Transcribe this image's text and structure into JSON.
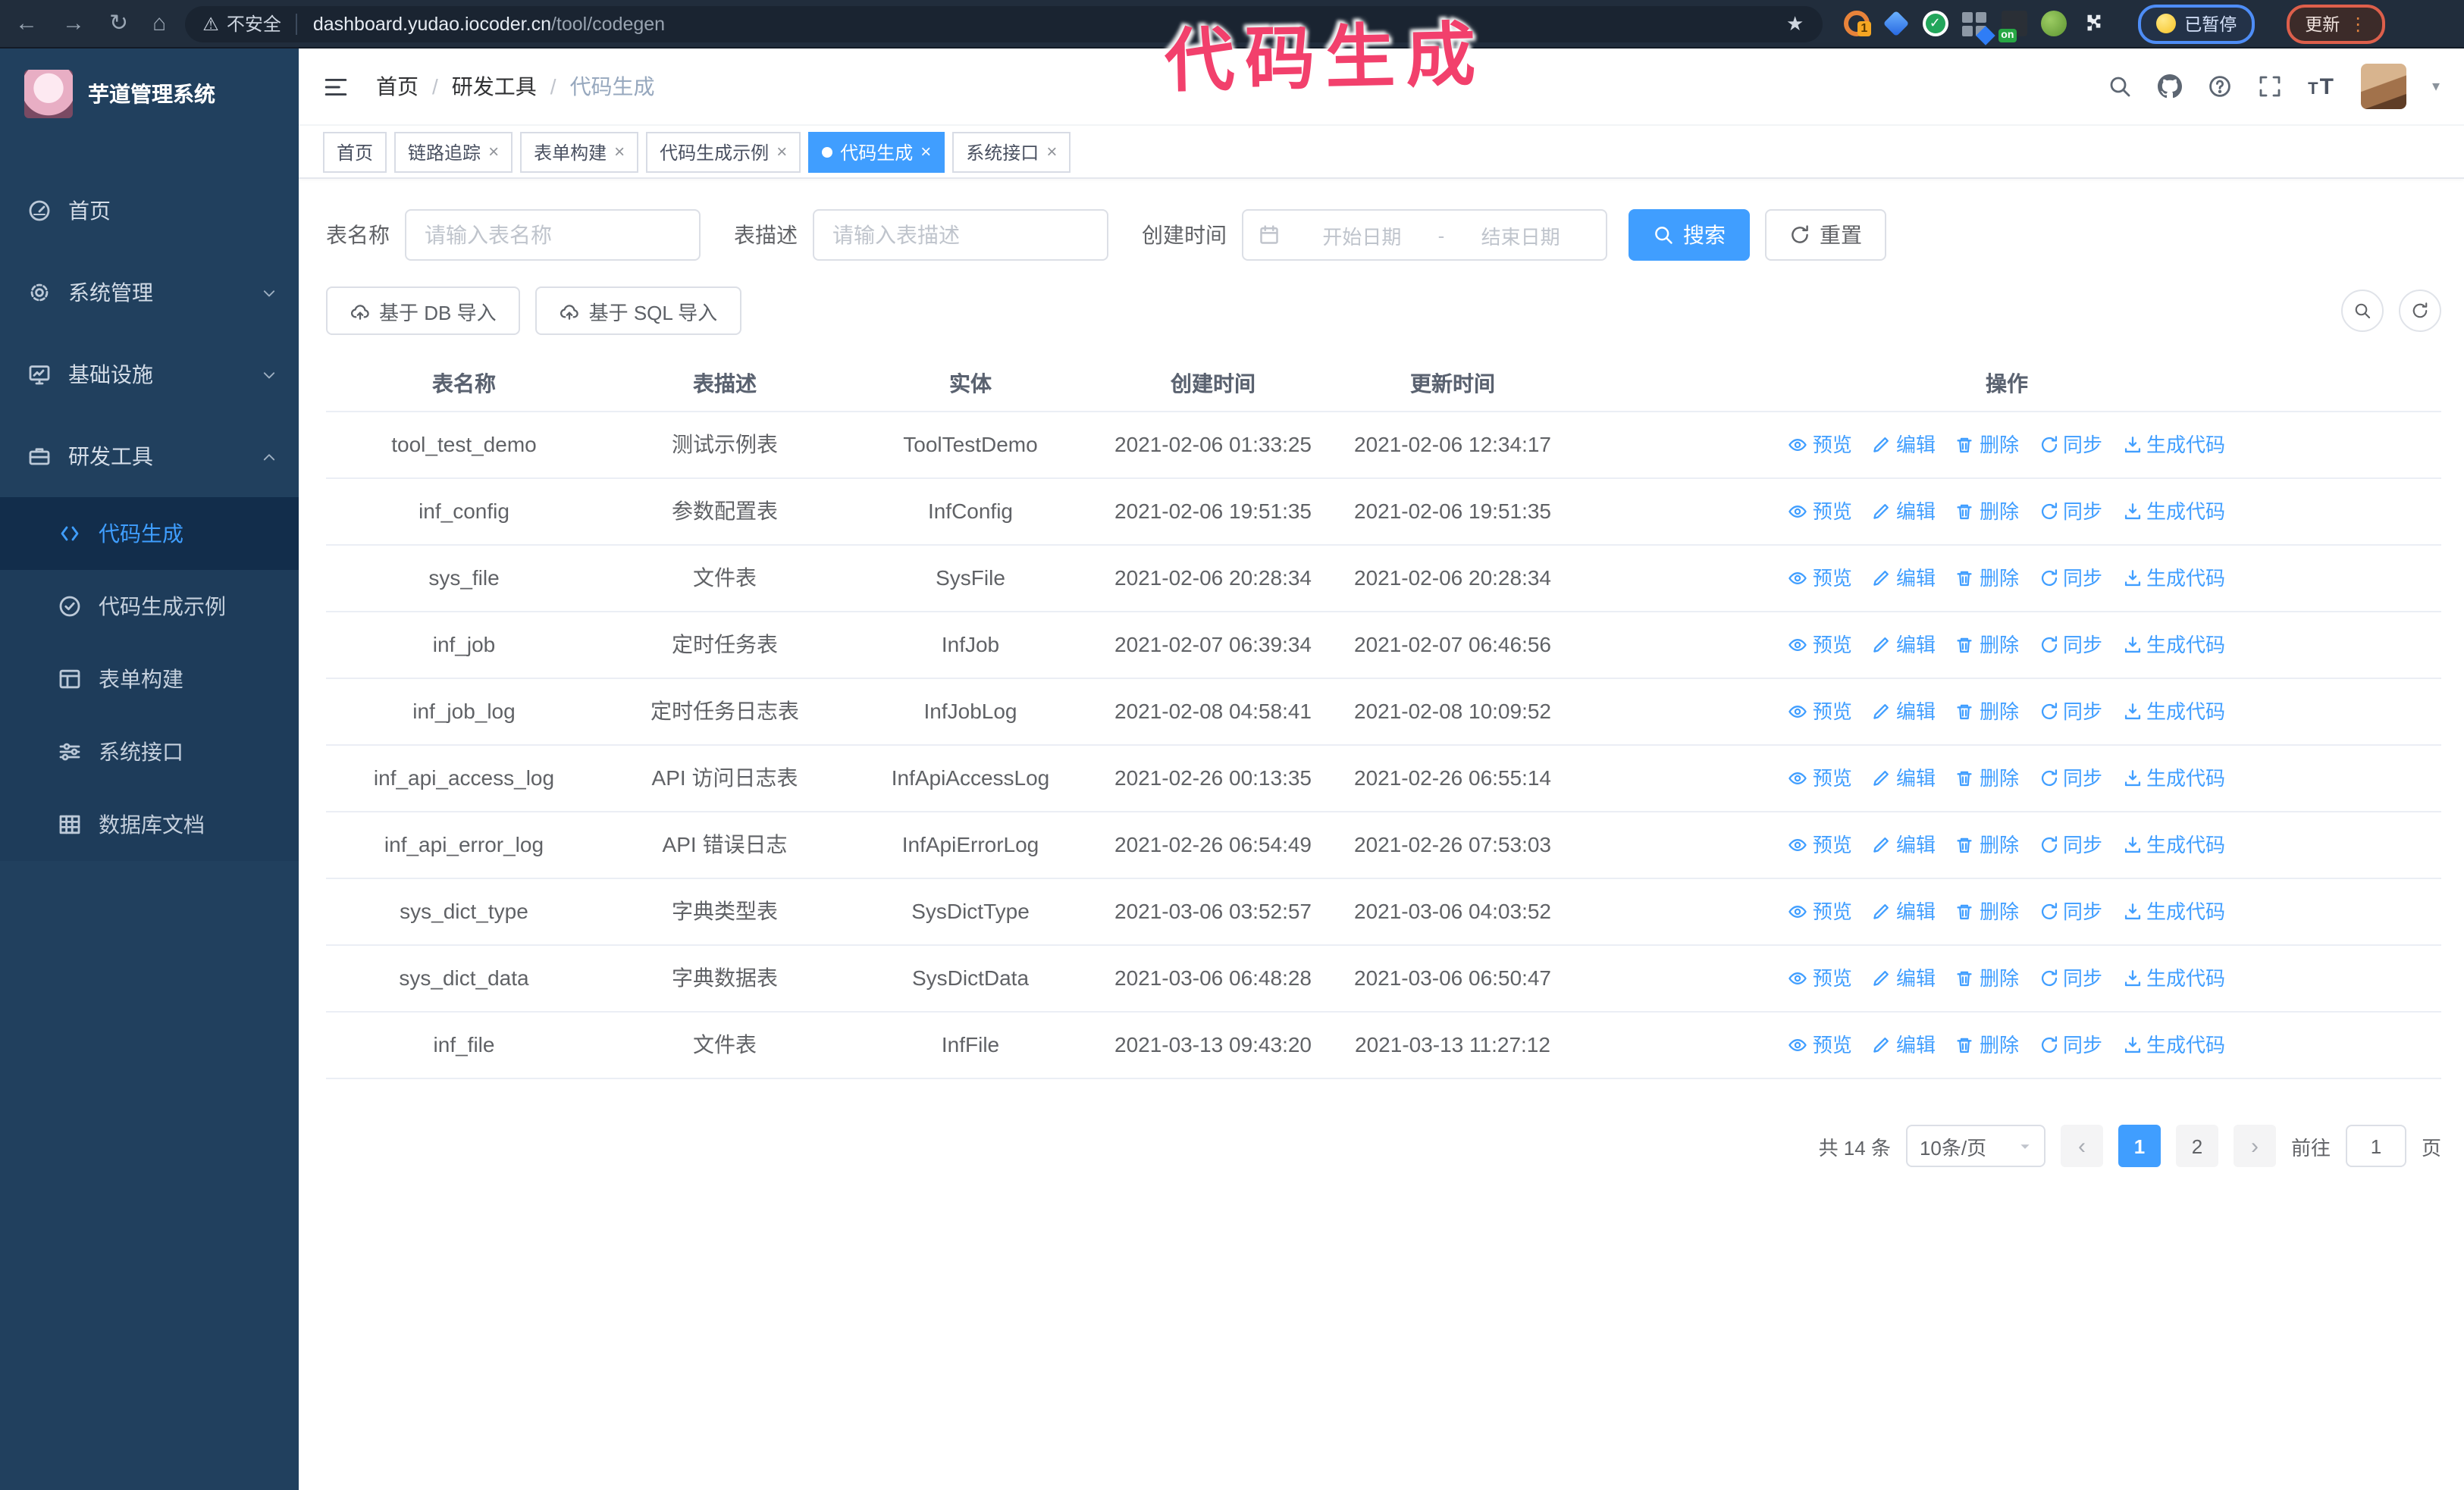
{
  "browser": {
    "security_label": "不安全",
    "url_host": "dashboard.yudao.iocoder.cn",
    "url_path": "/tool/codegen",
    "extension_badge": "1",
    "extension_on_label": "on",
    "paused_label": "已暂停",
    "update_label": "更新"
  },
  "annotation": {
    "text": "代码生成",
    "color": "#f2406c"
  },
  "sidebar": {
    "logo_title": "芋道管理系统",
    "menu": [
      {
        "label": "首页",
        "icon": "dashboard-icon",
        "expandable": false
      },
      {
        "label": "系统管理",
        "icon": "gear-icon",
        "expandable": true,
        "chevron": "down"
      },
      {
        "label": "基础设施",
        "icon": "monitor-icon",
        "expandable": true,
        "chevron": "down"
      },
      {
        "label": "研发工具",
        "icon": "toolbox-icon",
        "expandable": true,
        "chevron": "up",
        "expanded": true
      }
    ],
    "submenu": [
      {
        "label": "代码生成",
        "icon": "code-icon",
        "active": true
      },
      {
        "label": "代码生成示例",
        "icon": "check-circle-icon",
        "active": false
      },
      {
        "label": "表单构建",
        "icon": "form-icon",
        "active": false
      },
      {
        "label": "系统接口",
        "icon": "sliders-icon",
        "active": false
      },
      {
        "label": "数据库文档",
        "icon": "db-grid-icon",
        "active": false
      }
    ]
  },
  "header": {
    "breadcrumb": [
      "首页",
      "研发工具",
      "代码生成"
    ]
  },
  "tabs": [
    {
      "label": "首页",
      "closable": false,
      "active": false
    },
    {
      "label": "链路追踪",
      "closable": true,
      "active": false
    },
    {
      "label": "表单构建",
      "closable": true,
      "active": false
    },
    {
      "label": "代码生成示例",
      "closable": true,
      "active": false
    },
    {
      "label": "代码生成",
      "closable": true,
      "active": true
    },
    {
      "label": "系统接口",
      "closable": true,
      "active": false
    }
  ],
  "search": {
    "name_label": "表名称",
    "name_placeholder": "请输入表名称",
    "desc_label": "表描述",
    "desc_placeholder": "请输入表描述",
    "time_label": "创建时间",
    "start_placeholder": "开始日期",
    "separator": "-",
    "end_placeholder": "结束日期",
    "search_button": "搜索",
    "reset_button": "重置"
  },
  "toolbar": {
    "import_db_button": "基于 DB 导入",
    "import_sql_button": "基于 SQL 导入"
  },
  "table": {
    "columns": [
      "表名称",
      "表描述",
      "实体",
      "创建时间",
      "更新时间",
      "操作"
    ],
    "actions": [
      {
        "label": "预览",
        "icon": "eye-icon"
      },
      {
        "label": "编辑",
        "icon": "edit-icon"
      },
      {
        "label": "删除",
        "icon": "delete-icon"
      },
      {
        "label": "同步",
        "icon": "sync-icon"
      },
      {
        "label": "生成代码",
        "icon": "download-icon"
      }
    ],
    "rows": [
      {
        "name": "tool_test_demo",
        "description": "测试示例表",
        "entity": "ToolTestDemo",
        "created": "2021-02-06 01:33:25",
        "updated": "2021-02-06 12:34:17"
      },
      {
        "name": "inf_config",
        "description": "参数配置表",
        "entity": "InfConfig",
        "created": "2021-02-06 19:51:35",
        "updated": "2021-02-06 19:51:35"
      },
      {
        "name": "sys_file",
        "description": "文件表",
        "entity": "SysFile",
        "created": "2021-02-06 20:28:34",
        "updated": "2021-02-06 20:28:34"
      },
      {
        "name": "inf_job",
        "description": "定时任务表",
        "entity": "InfJob",
        "created": "2021-02-07 06:39:34",
        "updated": "2021-02-07 06:46:56"
      },
      {
        "name": "inf_job_log",
        "description": "定时任务日志表",
        "entity": "InfJobLog",
        "created": "2021-02-08 04:58:41",
        "updated": "2021-02-08 10:09:52"
      },
      {
        "name": "inf_api_access_log",
        "description": "API 访问日志表",
        "entity": "InfApiAccessLog",
        "created": "2021-02-26 00:13:35",
        "updated": "2021-02-26 06:55:14"
      },
      {
        "name": "inf_api_error_log",
        "description": "API 错误日志",
        "entity": "InfApiErrorLog",
        "created": "2021-02-26 06:54:49",
        "updated": "2021-02-26 07:53:03"
      },
      {
        "name": "sys_dict_type",
        "description": "字典类型表",
        "entity": "SysDictType",
        "created": "2021-03-06 03:52:57",
        "updated": "2021-03-06 04:03:52"
      },
      {
        "name": "sys_dict_data",
        "description": "字典数据表",
        "entity": "SysDictData",
        "created": "2021-03-06 06:48:28",
        "updated": "2021-03-06 06:50:47"
      },
      {
        "name": "inf_file",
        "description": "文件表",
        "entity": "InfFile",
        "created": "2021-03-13 09:43:20",
        "updated": "2021-03-13 11:27:12"
      }
    ]
  },
  "pagination": {
    "total": "共 14 条",
    "page_size": "10条/页",
    "pages": [
      "1",
      "2"
    ],
    "current_page": "1",
    "goto_label": "前往",
    "goto_value": "1",
    "page_unit": "页"
  },
  "colors": {
    "accent": "#409eff",
    "sidebar_bg": "#21405e",
    "annotation_pink": "#f2406c"
  }
}
